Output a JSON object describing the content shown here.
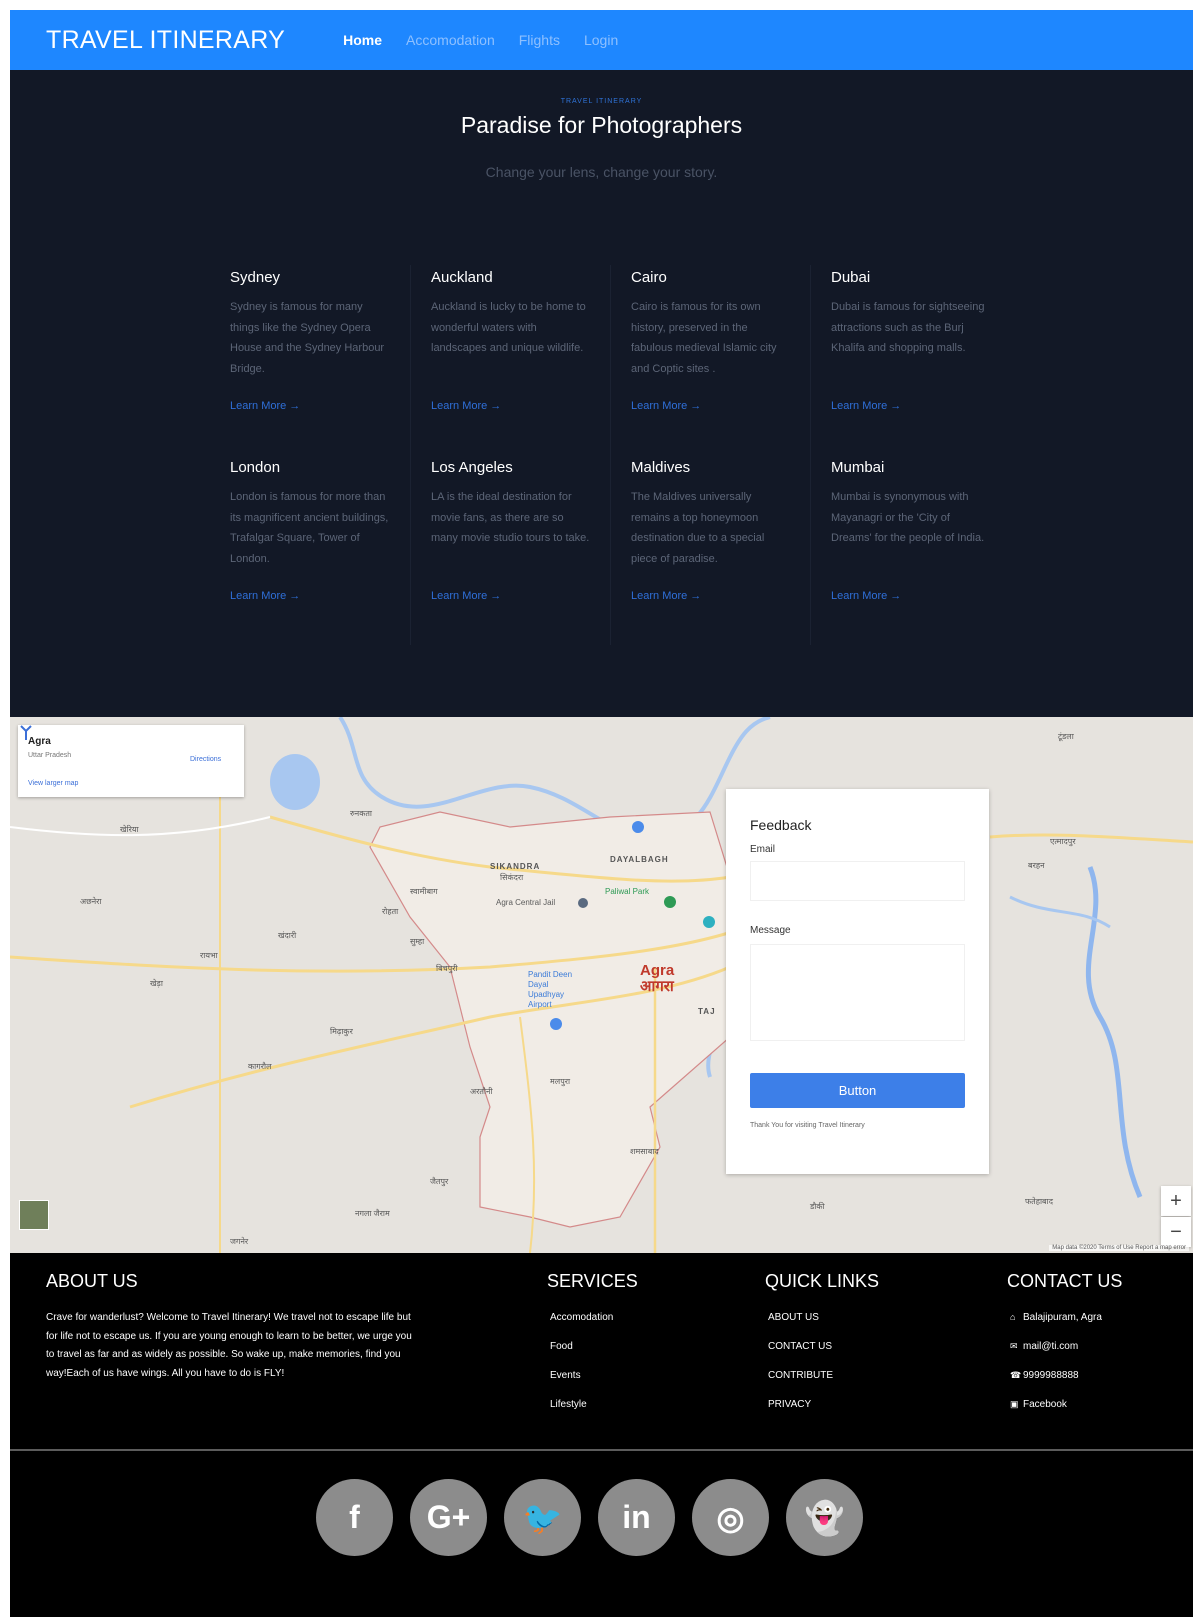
{
  "nav": {
    "brand": "TRAVEL ITINERARY",
    "links": [
      "Home",
      "Accomodation",
      "Flights",
      "Login"
    ],
    "active": "Home",
    "bg_color": "#1e87ff"
  },
  "hero": {
    "eyebrow": "TRAVEL ITINERARY",
    "title": "Paradise for Photographers",
    "subtitle": "Change your lens, change your story.",
    "cards": [
      {
        "title": "Sydney",
        "text": "Sydney is famous for many things like the Sydney Opera House and the Sydney Harbour Bridge.",
        "link": "Learn More →"
      },
      {
        "title": "Auckland",
        "text": "Auckland is lucky to be home to wonderful waters with landscapes and unique wildlife.",
        "link": "Learn More →"
      },
      {
        "title": "Cairo",
        "text": "Cairo is famous for its own history, preserved in the fabulous medieval Islamic city and Coptic sites .",
        "link": "Learn More →"
      },
      {
        "title": "Dubai",
        "text": "Dubai is famous for sightseeing attractions such as the Burj Khalifa and shopping malls.",
        "link": "Learn More →"
      },
      {
        "title": "London",
        "text": "London is famous for more than its magnificent ancient buildings, Trafalgar Square, Tower of London.",
        "link": "Learn More →"
      },
      {
        "title": "Los Angeles",
        "text": "LA is the ideal destination for movie fans, as there are so many movie studio tours to take.",
        "link": "Learn More →"
      },
      {
        "title": "Maldives",
        "text": "The Maldives universally remains a top honeymoon destination due to a special piece of paradise.",
        "link": "Learn More →"
      },
      {
        "title": "Mumbai",
        "text": "Mumbai is synonymous with Mayanagri or the 'City of Dreams' for the people of India.",
        "link": "Learn More →"
      }
    ]
  },
  "map": {
    "info_title": "Agra",
    "info_sub": "Uttar Pradesh",
    "larger_map": "View larger map",
    "directions": "Directions",
    "labels": {
      "city": "Agra",
      "city_hindi": "आगरा",
      "sikandra": "SIKANDRA",
      "dayalbagh": "DAYALBAGH",
      "taj": "TAJ",
      "agra_central_jail": "Agra Central Jail",
      "paliwal_park": "Paliwal Park",
      "airport": "Pandit Deen Dayal Upadhyay Airport",
      "sikandra_hindi": "सिकंदरा",
      "kheria": "खेरिया",
      "jagner": "जगनेर",
      "khandari": "खंदारी",
      "raibha": "रायभा",
      "sumha": "सुम्हा",
      "kagarol": "कागरौल",
      "bichpuri": "बिचपुरी",
      "midhakur": "मिढ़ाकुर",
      "shamsabad": "शमसाबाद",
      "etmadpur": "एत्मादपुर",
      "tundla": "टूंडला",
      "runkata": "रुनकता",
      "achhnera": "अछनेरा",
      "fatehabad": "फतेहाबाद",
      "dauki": "डौकी",
      "barhan": "बरहन",
      "malpura": "मलपुरा",
      "artauni": "अरतौनी",
      "swamibagh": "स्वामीबाग",
      "rohta": "रोहता",
      "khera": "खेड़ा",
      "jaitpur": "जैतपुर",
      "nagla_jairam": "नगला जैराम"
    },
    "zoom_in": "+",
    "zoom_out": "−",
    "attribution": "Map data ©2020  Terms of Use  Report a map error"
  },
  "feedback": {
    "title": "Feedback",
    "email_label": "Email",
    "message_label": "Message",
    "button": "Button",
    "note": "Thank You for visiting Travel Itinerary",
    "button_color": "#3d7fe8"
  },
  "footer": {
    "about_title": "ABOUT US",
    "about_text": "Crave for wanderlust? Welcome to Travel Itinerary! We travel not to escape life but for life not to escape us. If you are young enough to learn to be better, we urge you to travel as far and as widely as possible. So wake up, make memories, find you way!Each of us have wings. All you have to do is FLY!",
    "services_title": "SERVICES",
    "services": [
      "Accomodation",
      "Food",
      "Events",
      "Lifestyle"
    ],
    "quick_title": "QUICK LINKS",
    "quick": [
      "ABOUT US",
      "CONTACT US",
      "CONTRIBUTE",
      "PRIVACY"
    ],
    "contact_title": "CONTACT US",
    "contact": [
      {
        "icon": "home-icon",
        "text": "Balajipuram, Agra"
      },
      {
        "icon": "envelope-icon",
        "text": "mail@ti.com"
      },
      {
        "icon": "phone-icon",
        "text": "9999988888"
      },
      {
        "icon": "facebook-square-icon",
        "text": "Facebook"
      }
    ],
    "socials": [
      {
        "icon": "facebook-icon",
        "glyph": "f"
      },
      {
        "icon": "google-plus-icon",
        "glyph": "G+"
      },
      {
        "icon": "twitter-icon",
        "glyph": "🐦"
      },
      {
        "icon": "linkedin-icon",
        "glyph": "in"
      },
      {
        "icon": "dribbble-icon",
        "glyph": "◎"
      },
      {
        "icon": "snapchat-icon",
        "glyph": "👻"
      }
    ]
  }
}
